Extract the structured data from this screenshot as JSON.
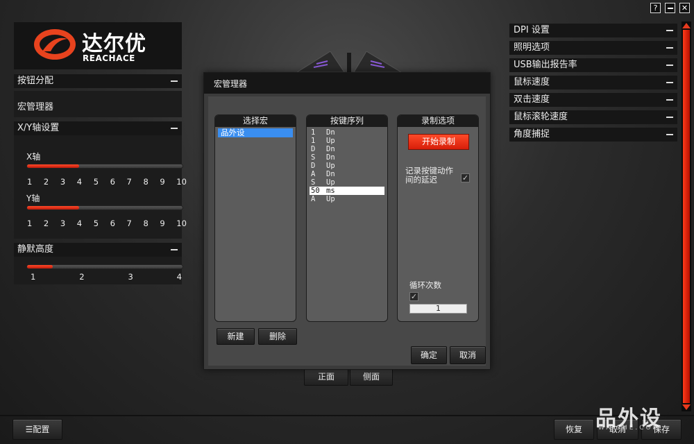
{
  "window": {
    "help_label": "?",
    "minimize_label": "",
    "close_label": "✕"
  },
  "brand": {
    "name_cn": "达尔优",
    "name_en": "REACHACE"
  },
  "left": {
    "button_assign": {
      "label": "按钮分配"
    },
    "macro_manager": {
      "label": "宏管理器"
    },
    "xy_axis": {
      "label": "X/Y轴设置",
      "x_label": "X轴",
      "x_value": 4,
      "y_label": "Y轴",
      "y_value": 4,
      "ticks": [
        "1",
        "2",
        "3",
        "4",
        "5",
        "6",
        "7",
        "8",
        "9",
        "10"
      ]
    },
    "lod": {
      "label": "静默高度",
      "value": 1.5,
      "ticks": [
        "1",
        "2",
        "3",
        "4"
      ]
    }
  },
  "right": {
    "items": [
      {
        "label": "DPI 设置"
      },
      {
        "label": "照明选项"
      },
      {
        "label": "USB输出报告率"
      },
      {
        "label": "鼠标速度"
      },
      {
        "label": "双击速度"
      },
      {
        "label": "鼠标滚轮速度"
      },
      {
        "label": "角度捕捉"
      }
    ]
  },
  "dialog": {
    "title": "宏管理器",
    "select_macro": {
      "header": "选择宏",
      "items": [
        "品外设"
      ]
    },
    "key_sequence": {
      "header": "按键序列",
      "items": [
        {
          "key": "1",
          "action": "Dn"
        },
        {
          "key": "1",
          "action": "Up"
        },
        {
          "key": "D",
          "action": "Dn"
        },
        {
          "key": "S",
          "action": "Dn"
        },
        {
          "key": "D",
          "action": "Up"
        },
        {
          "key": "A",
          "action": "Dn"
        },
        {
          "key": "S",
          "action": "Up"
        },
        {
          "key": "50",
          "action": "ms",
          "selected": true
        },
        {
          "key": "A",
          "action": "Up"
        }
      ]
    },
    "record": {
      "header": "录制选项",
      "start_label": "开始录制",
      "delay_label": "记录按键动作间的延迟",
      "loop_label": "循环次数",
      "loop_value": "1"
    },
    "new_label": "新建",
    "delete_label": "删除",
    "ok_label": "确定",
    "cancel_label": "取消"
  },
  "view_tabs": {
    "front": "正面",
    "side": "侧面"
  },
  "bottom": {
    "profile_label": "配置",
    "restore_label": "恢复",
    "cancel_label": "取消",
    "save_label": "保存"
  },
  "watermark": {
    "text": "品外设",
    "sub": "WAISHE.COM"
  },
  "colors": {
    "accent": "#e83a1e",
    "selection": "#3a8ef0"
  }
}
